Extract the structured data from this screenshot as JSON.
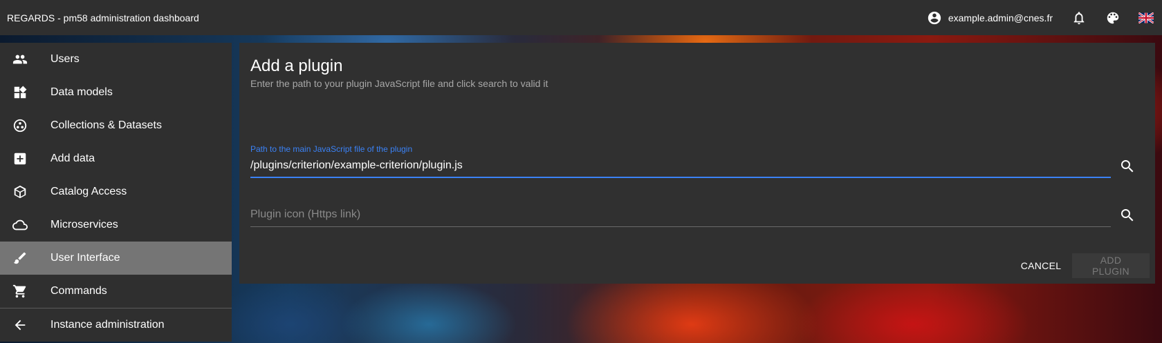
{
  "topbar": {
    "title": "REGARDS - pm58 administration dashboard",
    "user_email": "example.admin@cnes.fr",
    "icons": [
      "account-circle-icon",
      "notifications-icon",
      "palette-icon",
      "uk-flag-icon"
    ]
  },
  "sidebar": {
    "items": [
      {
        "label": "Users",
        "icon": "people-icon"
      },
      {
        "label": "Data models",
        "icon": "widgets-icon"
      },
      {
        "label": "Collections & Datasets",
        "icon": "collections-icon"
      },
      {
        "label": "Add data",
        "icon": "add-box-icon"
      },
      {
        "label": "Catalog Access",
        "icon": "catalog-cube-icon"
      },
      {
        "label": "Microservices",
        "icon": "cloud-icon"
      },
      {
        "label": "User Interface",
        "icon": "brush-icon",
        "active": true
      },
      {
        "label": "Commands",
        "icon": "cart-icon"
      },
      {
        "label": "Instance administration",
        "icon": "arrow-back-icon"
      }
    ]
  },
  "dialog": {
    "title": "Add a plugin",
    "subtitle": "Enter the path to your plugin JavaScript file and click search to valid it",
    "path_field": {
      "label": "Path to the main JavaScript file of the plugin",
      "value": "/plugins/criterion/example-criterion/plugin.js",
      "placeholder": ""
    },
    "icon_field": {
      "label": "",
      "value": "",
      "placeholder": "Plugin icon (Https link)"
    },
    "cancel_label": "Cancel",
    "add_label": "Add plugin"
  },
  "colors": {
    "accent": "#3b82f6",
    "panel": "#303030",
    "topbar": "#2f2f2f",
    "active_menu": "#757575"
  }
}
